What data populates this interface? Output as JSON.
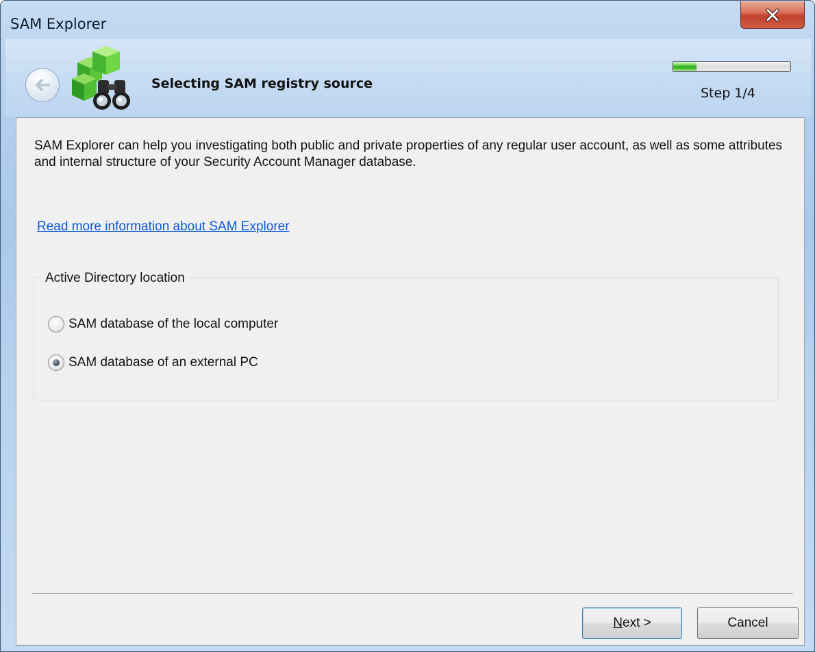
{
  "window": {
    "title": "SAM Explorer",
    "close_icon": "close-icon"
  },
  "header": {
    "back_icon": "back-arrow-icon",
    "app_icon": "sam-explorer-binoculars-icon",
    "page_title": "Selecting SAM registry source",
    "progress_fraction": 0.2,
    "step_label": "Step 1/4",
    "progress_color": "#48c22a"
  },
  "content": {
    "description": "SAM Explorer can help you investigating both public and private properties of any regular user account, as well as some attributes and internal structure of your Security Account Manager database.",
    "info_link": "Read more information about SAM Explorer",
    "link_color": "#0a5bd3",
    "group": {
      "legend": "Active Directory location",
      "options": [
        {
          "label": "SAM database of the local computer",
          "selected": false
        },
        {
          "label": "SAM database of an external PC",
          "selected": true
        }
      ]
    }
  },
  "footer": {
    "next_mnemonic": "N",
    "next_rest": "ext >",
    "cancel_label": "Cancel"
  }
}
